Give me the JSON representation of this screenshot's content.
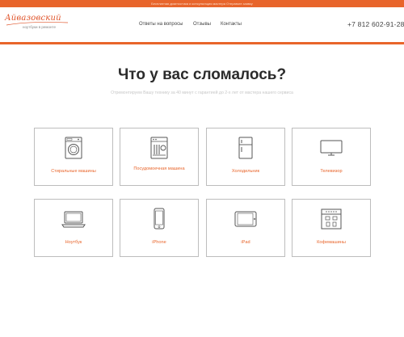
{
  "topbar": {
    "text": "Бесплатная диагностика и консультация мастера Отправьте заявку"
  },
  "header": {
    "logo_main": "Айвазовский",
    "logo_sub": "ноутбуки в ремонте",
    "nav": {
      "faq": "Ответы на вопросы",
      "reviews": "Отзывы",
      "contacts": "Контакты"
    },
    "phone": "+7 812 602-91-28"
  },
  "hero": {
    "title": "Что у вас сломалось?",
    "subtitle": "Отремонтируем Вашу технику за 40 минут с гарантией до 2-х лет от мастера нашего сервиса"
  },
  "categories": [
    {
      "label": "Стиральные машины",
      "icon": "washing-machine-icon"
    },
    {
      "label": "Посудомоечная машина",
      "icon": "dishwasher-icon"
    },
    {
      "label": "Холодильник",
      "icon": "fridge-icon"
    },
    {
      "label": "Телевизор",
      "icon": "tv-icon"
    },
    {
      "label": "Ноутбук",
      "icon": "laptop-icon"
    },
    {
      "label": "iPhone",
      "icon": "phone-icon"
    },
    {
      "label": "iPad",
      "icon": "tablet-icon"
    },
    {
      "label": "Кофемашины",
      "icon": "coffee-machine-icon"
    }
  ],
  "colors": {
    "accent": "#e8652b",
    "border": "#bdbdbd",
    "text": "#2b2b2b"
  }
}
